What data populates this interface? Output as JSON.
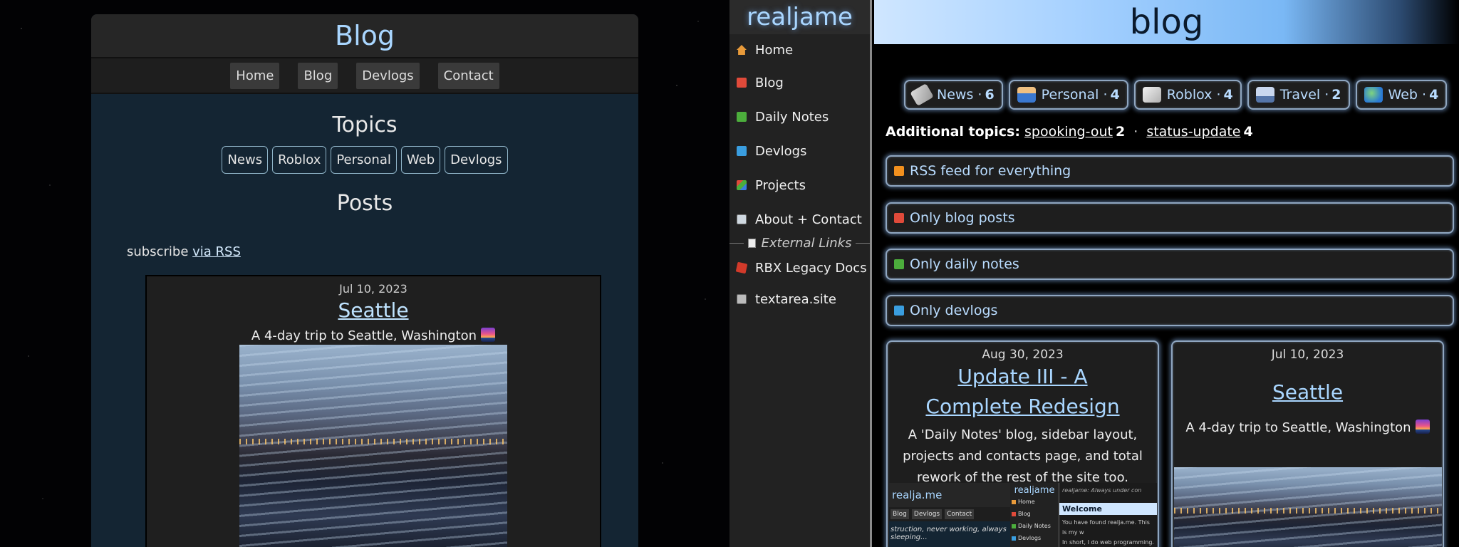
{
  "old_site": {
    "header_title": "Blog",
    "nav": [
      "Home",
      "Blog",
      "Devlogs",
      "Contact"
    ],
    "topics_heading": "Topics",
    "topics": [
      "News",
      "Roblox",
      "Personal",
      "Web",
      "Devlogs"
    ],
    "posts_heading": "Posts",
    "subscribe_text": "subscribe",
    "subscribe_link": "via RSS",
    "post": {
      "date": "Jul 10, 2023",
      "title": "Seattle",
      "description": "A 4-day trip to Seattle, Washington"
    }
  },
  "new_site": {
    "site_title": "realjame",
    "sidebar": {
      "items": [
        {
          "label": "Home",
          "icon": "home-icon"
        },
        {
          "label": "Blog",
          "icon": "rss-red-icon"
        },
        {
          "label": "Daily Notes",
          "icon": "rss-green-icon"
        },
        {
          "label": "Devlogs",
          "icon": "rss-blue-icon"
        },
        {
          "label": "Projects",
          "icon": "projects-icon"
        },
        {
          "label": "About + Contact",
          "icon": "contact-card-icon"
        }
      ],
      "external_label": "External Links",
      "external_items": [
        {
          "label": "RBX Legacy Docs",
          "icon": "roblox-icon"
        },
        {
          "label": "textarea.site",
          "icon": "textarea-icon"
        }
      ]
    },
    "banner_title": "blog",
    "topics": [
      {
        "label": "News",
        "count": "6",
        "icon": "newspaper-icon"
      },
      {
        "label": "Personal",
        "count": "4",
        "icon": "person-icon"
      },
      {
        "label": "Roblox",
        "count": "4",
        "icon": "roblox-block-icon"
      },
      {
        "label": "Travel",
        "count": "2",
        "icon": "car-icon"
      },
      {
        "label": "Web",
        "count": "4",
        "icon": "globe-icon"
      }
    ],
    "topic_separator": "·",
    "additional": {
      "label": "Additional topics:",
      "topics": [
        {
          "label": "spooking-out",
          "count": "2"
        },
        {
          "label": "status-update",
          "count": "4"
        }
      ],
      "separator": "·"
    },
    "feeds": [
      "RSS feed for everything",
      "Only blog posts",
      "Only daily notes",
      "Only devlogs"
    ],
    "posts": [
      {
        "date": "Aug 30, 2023",
        "title": "Update III - A Complete Redesign",
        "description": "A 'Daily Notes' blog, sidebar layout, projects and contacts page, and total rework of the rest of the site too."
      },
      {
        "date": "Jul 10, 2023",
        "title": "Seattle",
        "description": "A 4-day trip to Seattle, Washington"
      }
    ],
    "mini_screenshot": {
      "old_title": "realja.me",
      "old_nav": [
        "Blog",
        "Devlogs",
        "Contact"
      ],
      "old_text": "struction, never working, always sleeping...",
      "sidebar_title": "realjame",
      "sidebar_items": [
        "Home",
        "Blog",
        "Daily Notes",
        "Devlogs"
      ],
      "header_text": "realjame: Always under con",
      "welcome": "Welcome",
      "p1": "You have found realja.me. This is my w",
      "p2": "In short, I do web programming. I also"
    }
  }
}
